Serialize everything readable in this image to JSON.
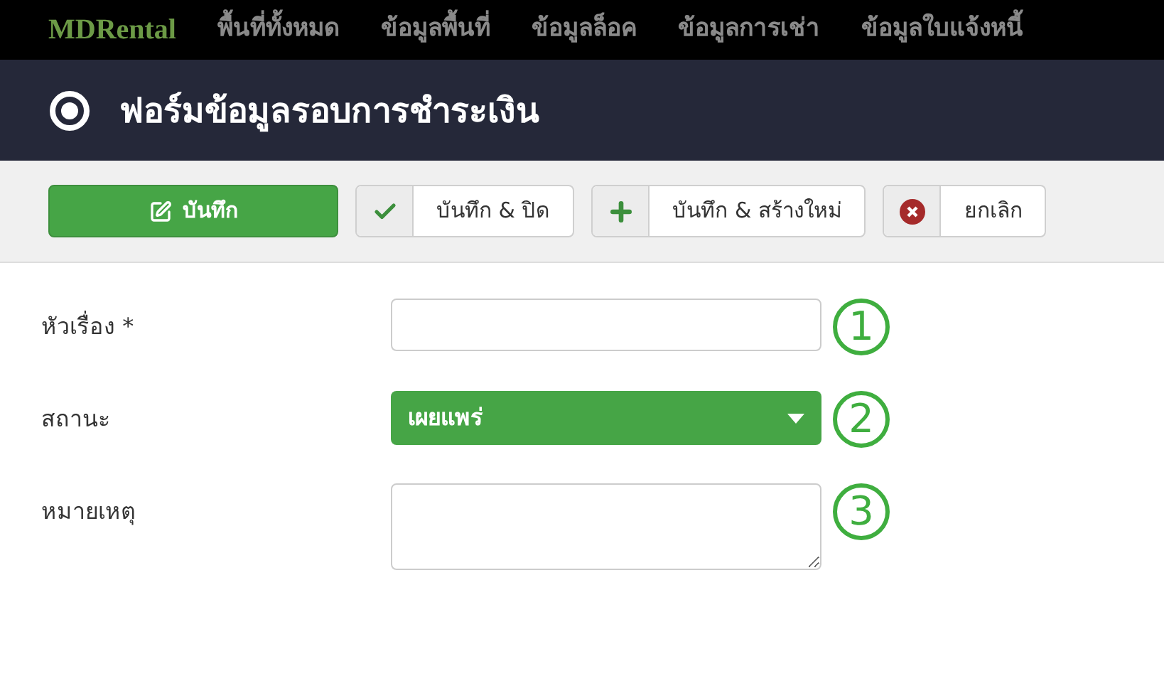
{
  "navbar": {
    "brand": "MDRental",
    "items": [
      "พื้นที่ทั้งหมด",
      "ข้อมูลพื้นที่",
      "ข้อมูลล็อค",
      "ข้อมูลการเช่า",
      "ข้อมูลใบแจ้งหนี้"
    ]
  },
  "page_title": "ฟอร์มข้อมูลรอบการชำระเงิน",
  "toolbar": [
    {
      "kind": "primary",
      "label": "บันทึก"
    },
    {
      "kind": "split",
      "label": "บันทึก & ปิด"
    },
    {
      "kind": "split",
      "label": "บันทึก & สร้างใหม่"
    },
    {
      "kind": "split",
      "label": "ยกเลิก"
    }
  ],
  "form": [
    {
      "kind": "text",
      "label": "หัวเรื่อง *",
      "marker": "1"
    },
    {
      "kind": "select",
      "label": "สถานะ",
      "value": "เผยแพร่",
      "marker": "2"
    },
    {
      "kind": "textarea",
      "label": "หมายเหตุ",
      "marker": "3"
    }
  ]
}
